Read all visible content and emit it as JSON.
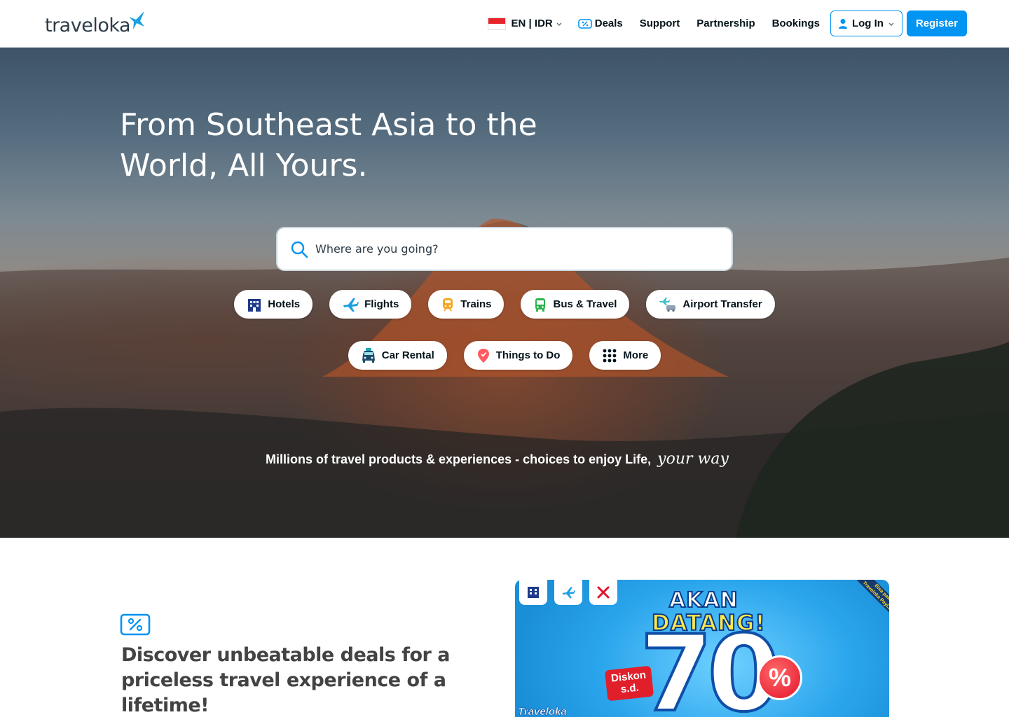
{
  "header": {
    "logo_text": "traveloka",
    "lang_label": "EN | IDR",
    "deals_label": "Deals",
    "support_label": "Support",
    "partnership_label": "Partnership",
    "bookings_label": "Bookings",
    "login_label": "Log In",
    "register_label": "Register"
  },
  "hero": {
    "title": "From Southeast Asia to the World, All Yours.",
    "search_placeholder": "Where are you going?",
    "products_row1": [
      {
        "label": "Hotels",
        "icon": "hotel-icon"
      },
      {
        "label": "Flights",
        "icon": "plane-icon"
      },
      {
        "label": "Trains",
        "icon": "train-icon"
      },
      {
        "label": "Bus & Travel",
        "icon": "bus-icon"
      },
      {
        "label": "Airport Transfer",
        "icon": "airport-transfer-icon"
      }
    ],
    "products_row2": [
      {
        "label": "Car Rental",
        "icon": "car-icon"
      },
      {
        "label": "Things to Do",
        "icon": "location-pin-icon"
      },
      {
        "label": "More",
        "icon": "grid-dots-icon"
      }
    ],
    "tagline": "Millions of travel products & experiences - choices to enjoy Life,",
    "tagline_script": "your way"
  },
  "deals": {
    "title": "Discover unbeatable deals for a priceless travel experience of a lifetime!",
    "banner": {
      "line1": "AKAN",
      "line2": "DATANG!",
      "big_number": "70",
      "percent": "%",
      "discount_badge_line1": "Diskon",
      "discount_badge_line2": "s.d.",
      "brand": "Traveloka",
      "ribbon_line1": "Bisa pakai",
      "ribbon_line2": "Traveloka PayLater"
    }
  },
  "colors": {
    "brand_blue": "#0194f3",
    "text_dark": "#03121a",
    "heading_grey": "#434343"
  }
}
